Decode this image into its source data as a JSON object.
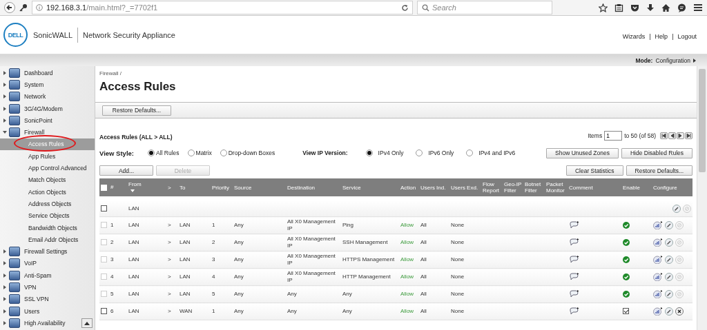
{
  "browser": {
    "url_host": "192.168.3.1",
    "url_path": "/main.html?_=7702f1",
    "search_placeholder": "Search"
  },
  "header": {
    "logo": "DELL",
    "brand": "SonicWALL",
    "product": "Network Security Appliance",
    "links": [
      "Wizards",
      "Help",
      "Logout"
    ],
    "link_separator": "|"
  },
  "mode_bar": {
    "label": "Mode:",
    "value": "Configuration"
  },
  "sidebar": {
    "items": [
      {
        "label": "Dashboard",
        "expanded": false
      },
      {
        "label": "System",
        "expanded": false
      },
      {
        "label": "Network",
        "expanded": false
      },
      {
        "label": "3G/4G/Modem",
        "expanded": false
      },
      {
        "label": "SonicPoint",
        "expanded": false
      },
      {
        "label": "Firewall",
        "expanded": true,
        "children": [
          {
            "label": "Access Rules",
            "selected": true,
            "circled": true
          },
          {
            "label": "App Rules",
            "selected": false,
            "circled": false
          },
          {
            "label": "App Control Advanced",
            "selected": false,
            "circled": false
          },
          {
            "label": "Match Objects",
            "selected": false,
            "circled": false
          },
          {
            "label": "Action Objects",
            "selected": false,
            "circled": false
          },
          {
            "label": "Address Objects",
            "selected": false,
            "circled": false
          },
          {
            "label": "Service Objects",
            "selected": false,
            "circled": false
          },
          {
            "label": "Bandwidth Objects",
            "selected": false,
            "circled": false
          },
          {
            "label": "Email Addr Objects",
            "selected": false,
            "circled": false
          }
        ]
      },
      {
        "label": "Firewall Settings",
        "expanded": false
      },
      {
        "label": "VoIP",
        "expanded": false
      },
      {
        "label": "Anti-Spam",
        "expanded": false
      },
      {
        "label": "VPN",
        "expanded": false
      },
      {
        "label": "SSL VPN",
        "expanded": false
      },
      {
        "label": "Users",
        "expanded": false
      },
      {
        "label": "High Availability",
        "expanded": false
      }
    ]
  },
  "page": {
    "breadcrumb": "Firewall /",
    "title": "Access Rules",
    "restore_button": "Restore Defaults...",
    "section_title": "Access Rules (ALL > ALL)",
    "pager": {
      "label": "Items",
      "value": "1",
      "range": "to 50 (of 58)"
    },
    "view_style": {
      "label": "View Style:",
      "options": [
        {
          "label": "All Rules",
          "selected": true
        },
        {
          "label": "Matrix",
          "selected": false
        },
        {
          "label": "Drop-down Boxes",
          "selected": false
        }
      ]
    },
    "ip_version": {
      "label": "View IP Version:",
      "options": [
        {
          "label": "IPv4 Only",
          "selected": true
        },
        {
          "label": "IPv6 Only",
          "selected": false
        },
        {
          "label": "IPv4 and IPv6",
          "selected": false
        }
      ]
    },
    "view_buttons": [
      "Show Unused Zones",
      "Hide Disabled Rules"
    ],
    "actions": [
      {
        "label": "Add...",
        "disabled": false
      },
      {
        "label": "Delete",
        "disabled": true
      }
    ],
    "right_actions": [
      "Clear Statistics",
      "Restore Defaults..."
    ]
  },
  "table": {
    "select_all": {
      "checked": false
    },
    "columns": [
      {
        "label": "#",
        "sorted": false
      },
      {
        "label": "From",
        "sorted": true
      },
      {
        "label": ">",
        "sorted": false
      },
      {
        "label": "To",
        "sorted": false
      },
      {
        "label": "Priority",
        "sorted": false
      },
      {
        "label": "Source",
        "sorted": false
      },
      {
        "label": "Destination",
        "sorted": false
      },
      {
        "label": "Service",
        "sorted": false
      },
      {
        "label": "Action",
        "sorted": false
      },
      {
        "label": "Users Ind.",
        "sorted": false
      },
      {
        "label": "Users Exd.",
        "sorted": false
      },
      {
        "label": "Flow Report",
        "sorted": false
      },
      {
        "label": "Geo-IP Filter",
        "sorted": false
      },
      {
        "label": "Botnet Filter",
        "sorted": false
      },
      {
        "label": "Packet Monitor",
        "sorted": false
      },
      {
        "label": "Comment",
        "sorted": false
      },
      {
        "label": "Enable",
        "sorted": false
      },
      {
        "label": "Configure",
        "sorted": false
      }
    ],
    "zone_row": {
      "zone": "LAN",
      "checked": false
    },
    "rows": [
      {
        "number": "1",
        "from": "LAN",
        "arrow": ">",
        "to": "LAN",
        "priority": "1",
        "source": "Any",
        "destination": "All X0 Management IP",
        "service": "Ping",
        "action": "Allow",
        "users_included": "All",
        "users_excluded": "None",
        "checked": false,
        "disabled": true,
        "enable": {
          "kind": "status",
          "on": true
        },
        "deletable": false
      },
      {
        "number": "2",
        "from": "LAN",
        "arrow": ">",
        "to": "LAN",
        "priority": "2",
        "source": "Any",
        "destination": "All X0 Management IP",
        "service": "SSH Management",
        "action": "Allow",
        "users_included": "All",
        "users_excluded": "None",
        "checked": false,
        "disabled": true,
        "enable": {
          "kind": "status",
          "on": true
        },
        "deletable": false
      },
      {
        "number": "3",
        "from": "LAN",
        "arrow": ">",
        "to": "LAN",
        "priority": "3",
        "source": "Any",
        "destination": "All X0 Management IP",
        "service": "HTTPS Management",
        "action": "Allow",
        "users_included": "All",
        "users_excluded": "None",
        "checked": false,
        "disabled": true,
        "enable": {
          "kind": "status",
          "on": true
        },
        "deletable": false
      },
      {
        "number": "4",
        "from": "LAN",
        "arrow": ">",
        "to": "LAN",
        "priority": "4",
        "source": "Any",
        "destination": "All X0 Management IP",
        "service": "HTTP Management",
        "action": "Allow",
        "users_included": "All",
        "users_excluded": "None",
        "checked": false,
        "disabled": true,
        "enable": {
          "kind": "status",
          "on": true
        },
        "deletable": false
      },
      {
        "number": "5",
        "from": "LAN",
        "arrow": ">",
        "to": "LAN",
        "priority": "5",
        "source": "Any",
        "destination": "Any",
        "service": "Any",
        "action": "Allow",
        "users_included": "All",
        "users_excluded": "None",
        "checked": false,
        "disabled": true,
        "enable": {
          "kind": "status",
          "on": true
        },
        "deletable": false
      },
      {
        "number": "6",
        "from": "LAN",
        "arrow": ">",
        "to": "WAN",
        "priority": "1",
        "source": "Any",
        "destination": "Any",
        "service": "Any",
        "action": "Allow",
        "users_included": "All",
        "users_excluded": "None",
        "checked": false,
        "disabled": false,
        "enable": {
          "kind": "checkbox",
          "on": true
        },
        "deletable": true
      }
    ]
  }
}
